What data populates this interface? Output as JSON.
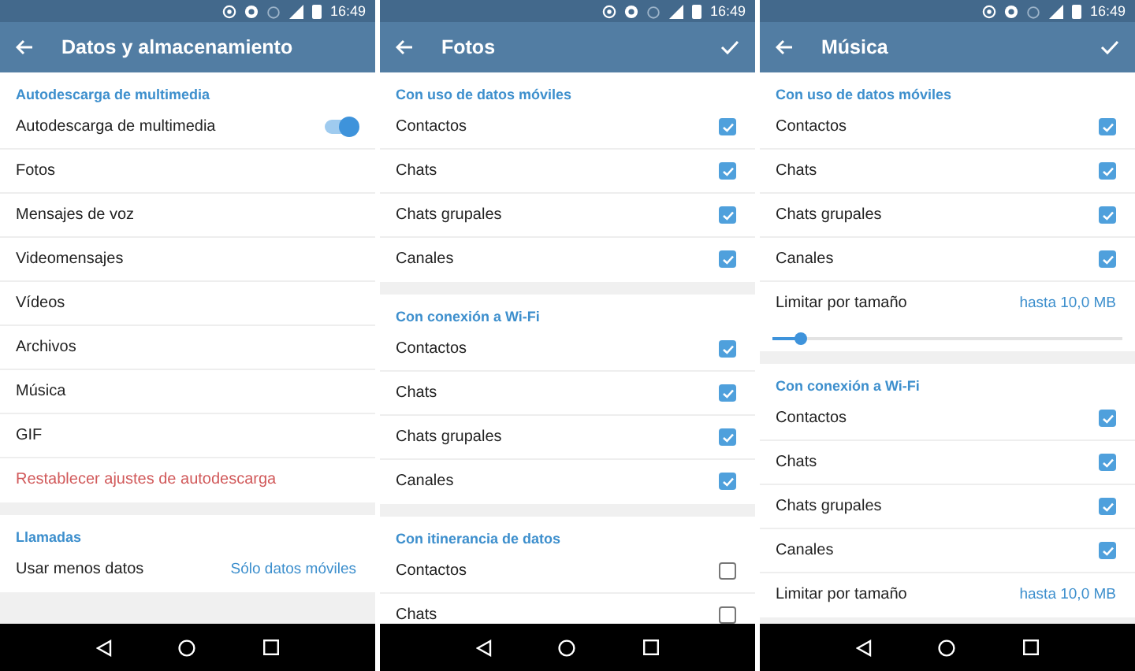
{
  "screens": [
    {
      "status_bar": {
        "time": "16:49"
      },
      "toolbar": {
        "title": "Datos y almacenamiento",
        "confirm": false
      },
      "sections": [
        {
          "header": "Autodescarga de multimedia",
          "items": [
            {
              "kind": "toggle",
              "label": "Autodescarga de multimedia",
              "on": true
            },
            {
              "kind": "link",
              "label": "Fotos"
            },
            {
              "kind": "link",
              "label": "Mensajes de voz"
            },
            {
              "kind": "link",
              "label": "Videomensajes"
            },
            {
              "kind": "link",
              "label": "Vídeos"
            },
            {
              "kind": "link",
              "label": "Archivos"
            },
            {
              "kind": "link",
              "label": "Música"
            },
            {
              "kind": "link",
              "label": "GIF"
            },
            {
              "kind": "danger",
              "label": "Restablecer ajustes de autodescarga"
            }
          ]
        },
        {
          "header": "Llamadas",
          "items": [
            {
              "kind": "value",
              "label": "Usar menos datos",
              "value": "Sólo datos móviles"
            }
          ]
        }
      ]
    },
    {
      "status_bar": {
        "time": "16:49"
      },
      "toolbar": {
        "title": "Fotos",
        "confirm": true
      },
      "sections": [
        {
          "header": "Con uso de datos móviles",
          "items": [
            {
              "kind": "checkbox",
              "label": "Contactos",
              "checked": true
            },
            {
              "kind": "checkbox",
              "label": "Chats",
              "checked": true
            },
            {
              "kind": "checkbox",
              "label": "Chats grupales",
              "checked": true
            },
            {
              "kind": "checkbox",
              "label": "Canales",
              "checked": true
            }
          ]
        },
        {
          "header": "Con conexión a Wi-Fi",
          "items": [
            {
              "kind": "checkbox",
              "label": "Contactos",
              "checked": true
            },
            {
              "kind": "checkbox",
              "label": "Chats",
              "checked": true
            },
            {
              "kind": "checkbox",
              "label": "Chats grupales",
              "checked": true
            },
            {
              "kind": "checkbox",
              "label": "Canales",
              "checked": true
            }
          ]
        },
        {
          "header": "Con itinerancia de datos",
          "items": [
            {
              "kind": "checkbox",
              "label": "Contactos",
              "checked": false
            },
            {
              "kind": "checkbox",
              "label": "Chats",
              "checked": false
            }
          ]
        }
      ]
    },
    {
      "status_bar": {
        "time": "16:49"
      },
      "toolbar": {
        "title": "Música",
        "confirm": true
      },
      "sections": [
        {
          "header": "Con uso de datos móviles",
          "items": [
            {
              "kind": "checkbox",
              "label": "Contactos",
              "checked": true
            },
            {
              "kind": "checkbox",
              "label": "Chats",
              "checked": true
            },
            {
              "kind": "checkbox",
              "label": "Chats grupales",
              "checked": true
            },
            {
              "kind": "checkbox",
              "label": "Canales",
              "checked": true
            },
            {
              "kind": "value",
              "label": "Limitar por tamaño",
              "value": "hasta 10,0 MB"
            },
            {
              "kind": "slider",
              "level": 0.08
            }
          ]
        },
        {
          "header": "Con conexión a Wi-Fi",
          "items": [
            {
              "kind": "checkbox",
              "label": "Contactos",
              "checked": true
            },
            {
              "kind": "checkbox",
              "label": "Chats",
              "checked": true
            },
            {
              "kind": "checkbox",
              "label": "Chats grupales",
              "checked": true
            },
            {
              "kind": "checkbox",
              "label": "Canales",
              "checked": true
            },
            {
              "kind": "value",
              "label": "Limitar por tamaño",
              "value": "hasta 10,0 MB"
            }
          ]
        }
      ]
    }
  ]
}
